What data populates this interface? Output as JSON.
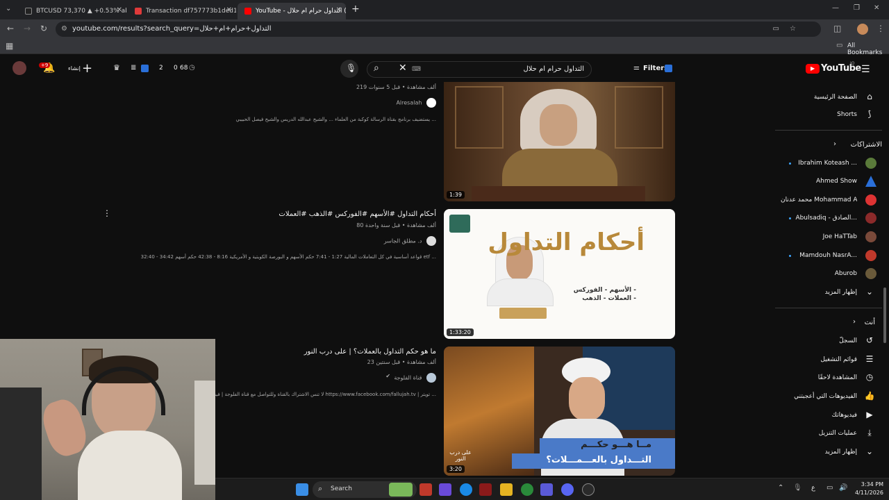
{
  "browser": {
    "tabs": [
      {
        "label": "BTCUSD 73,370 ▲ +0.53% abo...",
        "active": false
      },
      {
        "label": "Transaction df757773b1ded13...",
        "active": false
      },
      {
        "label": "(24) التداول حرام ام حلال - YouTube",
        "active": true
      }
    ],
    "new_tab": "+",
    "url": "youtube.com/results?search_query=التداول+حرام+ام+حلال",
    "bookmarks_label": "All Bookmarks"
  },
  "header": {
    "logo": "YouTube",
    "logo_sup": "JO",
    "search_value": "التداول حرام ام حلال",
    "filters_label": "Filters",
    "create_label": "إنشاء",
    "notif_badge": "+9",
    "stats": {
      "a": "2",
      "b": "0",
      "c": "68"
    }
  },
  "sidebar": {
    "main": [
      {
        "label": "الصفحة الرئيسية",
        "icon": "home-icon"
      },
      {
        "label": "Shorts",
        "icon": "shorts-icon"
      }
    ],
    "subs_title": "الاشتراكات",
    "subs": [
      {
        "label": "Ibrahim Koteash ...",
        "dot": true,
        "color": "#5a7a3a"
      },
      {
        "label": "Ahmed Show",
        "dot": false,
        "color": "#2a6fd8"
      },
      {
        "label": "محمد عدنان Mohammad Adnan...",
        "dot": false,
        "color": "#d33"
      },
      {
        "label": "Abulsadiq - الصادق...",
        "dot": true,
        "color": "#8b2a2a"
      },
      {
        "label": "Joe HaTTab",
        "dot": false,
        "color": "#7a4a3a"
      },
      {
        "label": "Mamdouh NasrA...",
        "dot": true,
        "color": "#c0392b"
      },
      {
        "label": "Aburob",
        "dot": false,
        "color": "#6a5a3a"
      }
    ],
    "subs_more": "إظهار المزيد",
    "you_title": "أنت",
    "you": [
      {
        "label": "السجلّ",
        "icon": "history-icon"
      },
      {
        "label": "قوائم التشغيل",
        "icon": "playlists-icon"
      },
      {
        "label": "المشاهدة لاحقًا",
        "icon": "watch-later-icon"
      },
      {
        "label": "الفيديوهات التي أعجبتني",
        "icon": "liked-icon"
      },
      {
        "label": "فيديوهاتك",
        "icon": "your-videos-icon"
      },
      {
        "label": "عمليات التنزيل",
        "icon": "downloads-icon"
      }
    ],
    "you_more": "إظهار المزيد"
  },
  "results": [
    {
      "title": "",
      "meta": "219 ألف مشاهدة • قبل 5 سنوات",
      "channel": "Alresalah",
      "desc": "يستضيف برنامج بقناة الرسالة كوكبة من العلماء ... والشيخ عبدالله الدريس والشيخ فيصل الحبيبي ...",
      "duration": "1:39"
    },
    {
      "title": "أحكام التداول #الأسهم #الفوركس #الذهب #العملات",
      "meta": "80 ألف مشاهدة • قبل سنة واحدة",
      "channel": "د. مطلق الجاسر",
      "desc": "قواعد أساسية في كل التعاملات المالية 1:27 - 7:41 حكم الأسهم و البورصة الكويتية و الأمريكية 8:16 - 42:38 حكم أسهم 34:42 - 32:40 etf ...",
      "duration": "1:33:20",
      "thumb_title": "أحكام التداول",
      "thumb_sub1": "- الأسهم - الفوركس",
      "thumb_sub2": "- العملات - الذهب"
    },
    {
      "title": "ما هو حكم التداول بالعملات؟ | على درب النور",
      "meta": "23 ألف مشاهدة • قبل سنتين",
      "channel": "قناة الفلوجة",
      "desc": "لا تنس الاشتراك بالقناة وللتواصل مع قناة الفلوجة | فيسبوك https://www.facebook.com/fallujah.tv | تويتر ...",
      "duration": "3:20",
      "thumb_line1": "مــا هـــو حكـــم",
      "thumb_line2": "التـــداول بالعـــمـــلات؟",
      "thumb_brand": "على درب النور"
    }
  ],
  "taskbar": {
    "search_label": "Search",
    "time": "3:34 PM",
    "date": "4/11/2026",
    "lang": "ع"
  }
}
